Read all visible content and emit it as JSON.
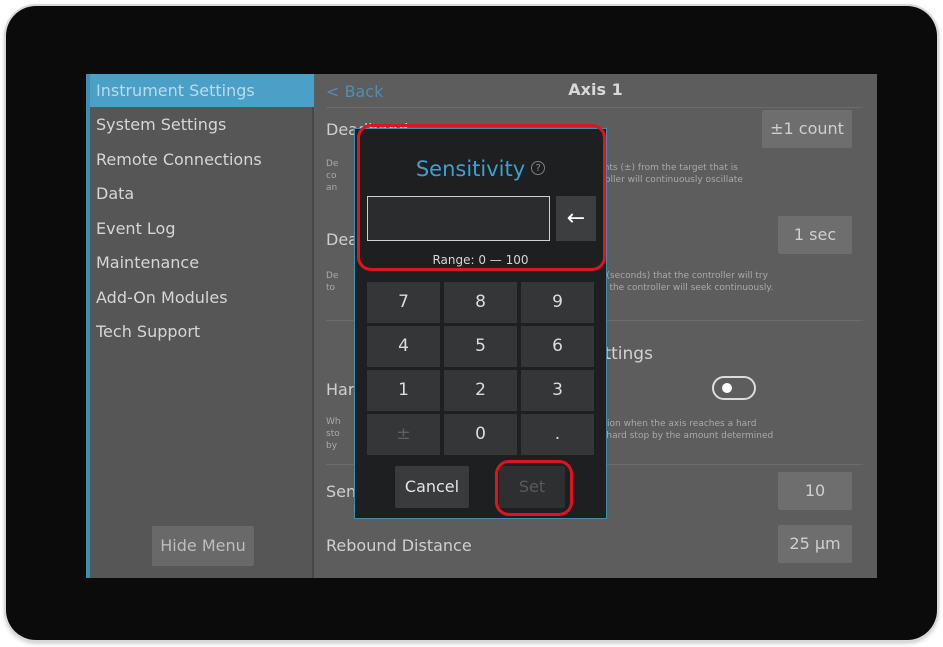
{
  "sidebar": {
    "items": [
      {
        "label": "Instrument Settings"
      },
      {
        "label": "System Settings"
      },
      {
        "label": "Remote Connections"
      },
      {
        "label": "Data"
      },
      {
        "label": "Event Log"
      },
      {
        "label": "Maintenance"
      },
      {
        "label": "Add-On Modules"
      },
      {
        "label": "Tech Support"
      }
    ],
    "hide_menu_label": "Hide Menu"
  },
  "header": {
    "back_label": "< Back",
    "title": "Axis 1"
  },
  "rows": {
    "deadband": {
      "label": "Deadband",
      "value": "±1 count",
      "desc_left": "De\nco\nan",
      "desc_right": "unts (±) from the target that is\ntroller will continuously oscillate"
    },
    "deadband_timeout": {
      "label": "Dea",
      "value": "1 sec",
      "desc_left": "De\nto",
      "desc_right": "e (seconds) that the controller will try\n0, the controller will seek continuously."
    },
    "section": {
      "title": "ettings"
    },
    "hard_stop": {
      "label": "Har",
      "desc_left": "Wh\nsto\nby",
      "desc_right": "otion when the axis reaches a hard\ne hard stop by the amount determined"
    },
    "sensitivity": {
      "label": "Sen",
      "value": "10"
    },
    "rebound": {
      "label": "Rebound Distance",
      "value": "25 µm"
    }
  },
  "dialog": {
    "title": "Sensitivity",
    "help_glyph": "?",
    "input_value": "",
    "backspace_glyph": "←",
    "range_text": "Range: 0 — 100",
    "keys": [
      "7",
      "8",
      "9",
      "4",
      "5",
      "6",
      "1",
      "2",
      "3",
      "±",
      "0",
      "."
    ],
    "cancel_label": "Cancel",
    "set_label": "Set"
  },
  "colors": {
    "accent": "#3ea0cf",
    "sidebar_active": "#4ba0c7",
    "highlight": "#e0141e",
    "dialog_bg": "#1e1f21"
  },
  "icons": {
    "help": "help-circle-icon",
    "backspace": "backspace-arrow-icon",
    "toggle": "toggle-switch-icon"
  }
}
